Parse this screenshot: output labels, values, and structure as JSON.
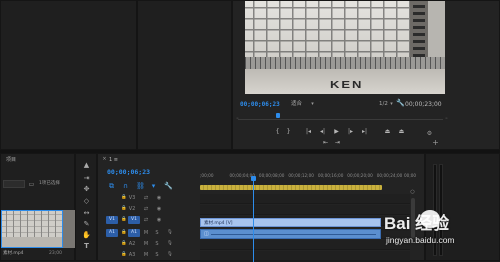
{
  "program_monitor": {
    "timecode": "00;00;06;23",
    "zoom": "适合",
    "resolution": "1/2",
    "duration": "00;00;23;00",
    "video_overlay_logo": "KEN"
  },
  "program_controls": [
    {
      "name": "mark-in",
      "glyph": "{"
    },
    {
      "name": "mark-out",
      "glyph": "}"
    },
    {
      "name": "go-to-in",
      "glyph": "|◂"
    },
    {
      "name": "step-back",
      "glyph": "◂|"
    },
    {
      "name": "play",
      "glyph": "▶"
    },
    {
      "name": "step-forward",
      "glyph": "|▸"
    },
    {
      "name": "go-to-out",
      "glyph": "▸|"
    },
    {
      "name": "lift",
      "glyph": "⏏"
    },
    {
      "name": "extract",
      "glyph": "⏏"
    }
  ],
  "program_controls_row2": [
    {
      "name": "insert",
      "glyph": "⇤"
    },
    {
      "name": "overwrite",
      "glyph": "⇥"
    }
  ],
  "project_panel": {
    "tab_label": "项目",
    "selection_text": "1项已选择",
    "clip_name": "素材.mp4",
    "clip_duration": "23;00"
  },
  "timeline": {
    "sequence_tab": "1 ≡",
    "timecode": "00;00;06;23",
    "ruler_ticks": [
      ";00;00",
      "00;00;04;00",
      "00;00;08;00",
      "00;00;12;00",
      "00;00;16;00",
      "00;00;20;00",
      "00;00;24;00",
      "00;00"
    ],
    "playhead_fraction": 0.29,
    "tracks": [
      {
        "name": "V3",
        "type": "video"
      },
      {
        "name": "V2",
        "type": "video"
      },
      {
        "name": "V1",
        "type": "video",
        "targeted": true
      },
      {
        "name": "A1",
        "type": "audio",
        "targeted": true
      },
      {
        "name": "A2",
        "type": "audio"
      },
      {
        "name": "A3",
        "type": "audio"
      }
    ],
    "video_clip_label": "素材.mp4 [V]",
    "audio_clip_label": ""
  },
  "watermark": {
    "site": "jingyan.baidu.com",
    "brand": "Bai 经验"
  },
  "colors": {
    "accent": "#2d8ceb",
    "clip_video": "#a7c4ef",
    "clip_audio": "#5b8fcf",
    "work_area": "#c9b13d"
  }
}
